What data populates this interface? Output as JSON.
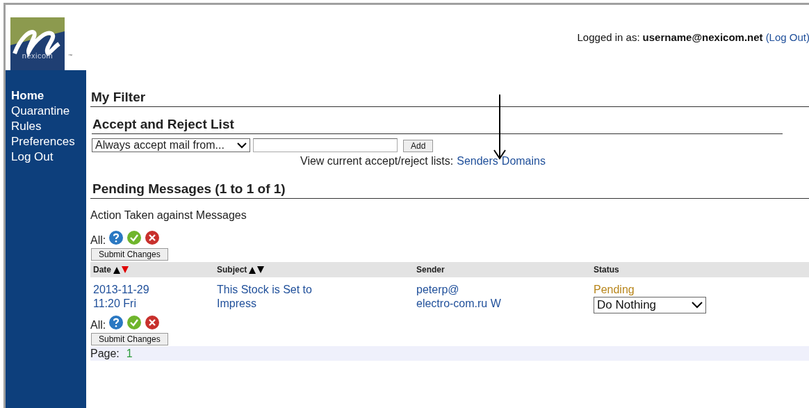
{
  "logo": {
    "name": "nexicom",
    "tm": "™"
  },
  "header": {
    "logged_in_label": "Logged in as:",
    "user": "username@nexicom.net",
    "logout": "(Log Out)"
  },
  "sidebar": {
    "items": [
      {
        "label": "Home",
        "selected": true
      },
      {
        "label": "Quarantine",
        "selected": false
      },
      {
        "label": "Rules",
        "selected": false
      },
      {
        "label": "Preferences",
        "selected": false
      },
      {
        "label": "Log Out",
        "selected": false
      }
    ]
  },
  "page_title": "My Filter",
  "accept_reject": {
    "title": "Accept and Reject List",
    "mode": "Always accept mail from...",
    "add_button": "Add",
    "view_label": "View current accept/reject lists:",
    "links": [
      "Senders",
      "Domains"
    ]
  },
  "pending": {
    "title": "Pending Messages (1 to 1 of 1)",
    "action_text": "Action Taken against Messages",
    "bars": [
      {
        "all_label": "All:",
        "submit": "Submit Changes"
      },
      {
        "all_label": "All:",
        "submit": "Submit Changes"
      }
    ],
    "columns": [
      {
        "label": "Date",
        "sorted": true
      },
      {
        "label": "Subject",
        "sorted": false
      },
      {
        "label": "Sender"
      },
      {
        "label": "Status"
      }
    ],
    "rows": [
      {
        "date": [
          "2013-11-29",
          "11:20 Fri"
        ],
        "subject": [
          "This Stock is Set to",
          "Impress"
        ],
        "sender": [
          "peterp@",
          "electro-com.ru W"
        ],
        "status": "Pending",
        "action": "Do Nothing"
      }
    ],
    "page_label": "Page:",
    "page": "1"
  }
}
